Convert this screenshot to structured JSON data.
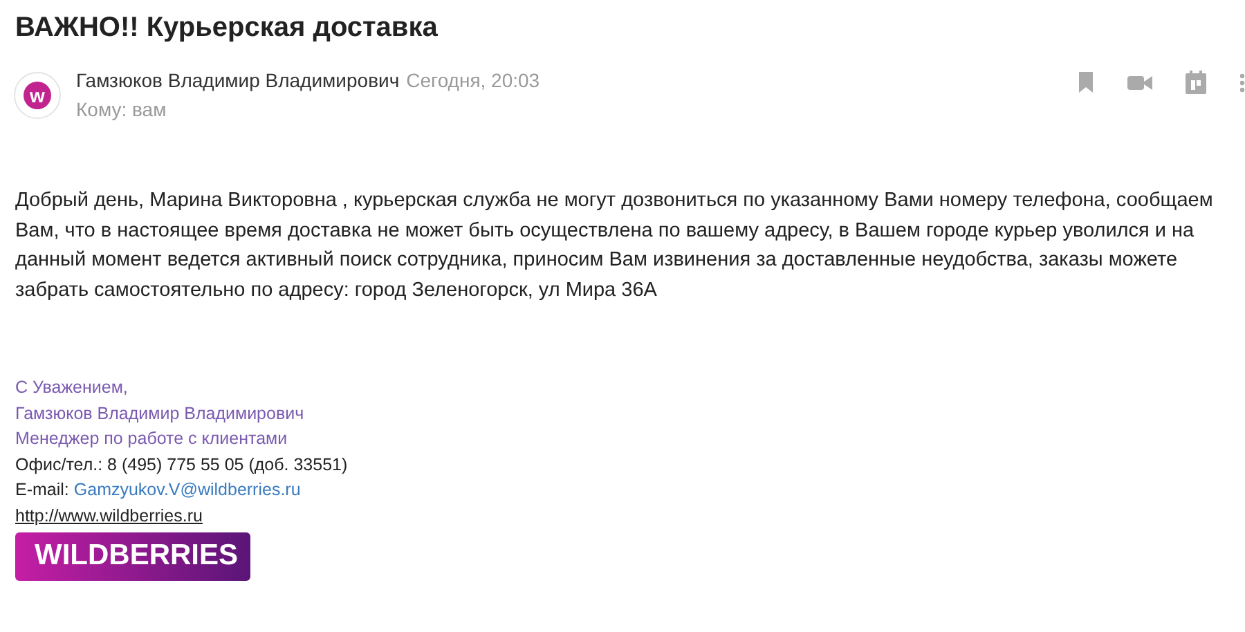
{
  "subject": "ВАЖНО!! Курьерская доставка",
  "sender": {
    "avatar_letter": "w",
    "name": "Гамзюков Владимир Владимирович",
    "time": "Сегодня, 20:03",
    "to": "Кому: вам"
  },
  "body": "Добрый день, Марина Викторовна , курьерская служба не могут дозвониться по указанному Вами номеру телефона, сообщаем Вам, что в настоящее время  доставка не может быть осуществлена по вашему адресу, в Вашем городе курьер уволился и на данный момент  ведется активный поиск сотрудника, приносим Вам извинения за доставленные неудобства, заказы можете забрать самостоятельно по адресу:  город Зеленогорск, ул Мира 36А",
  "signature": {
    "greeting": "С Уважением,",
    "name": "Гамзюков Владимир Владимирович",
    "position": "Менеджер по работе с клиентами",
    "phone": "Офис/тел.: 8 (495) 775 55 05  (доб. 33551)",
    "email_label": "E-mail:",
    "email": "Gamzyukov.V@wildberries.ru",
    "website": "http://www.wildberries.ru",
    "logo": "WILDBERRIES"
  }
}
